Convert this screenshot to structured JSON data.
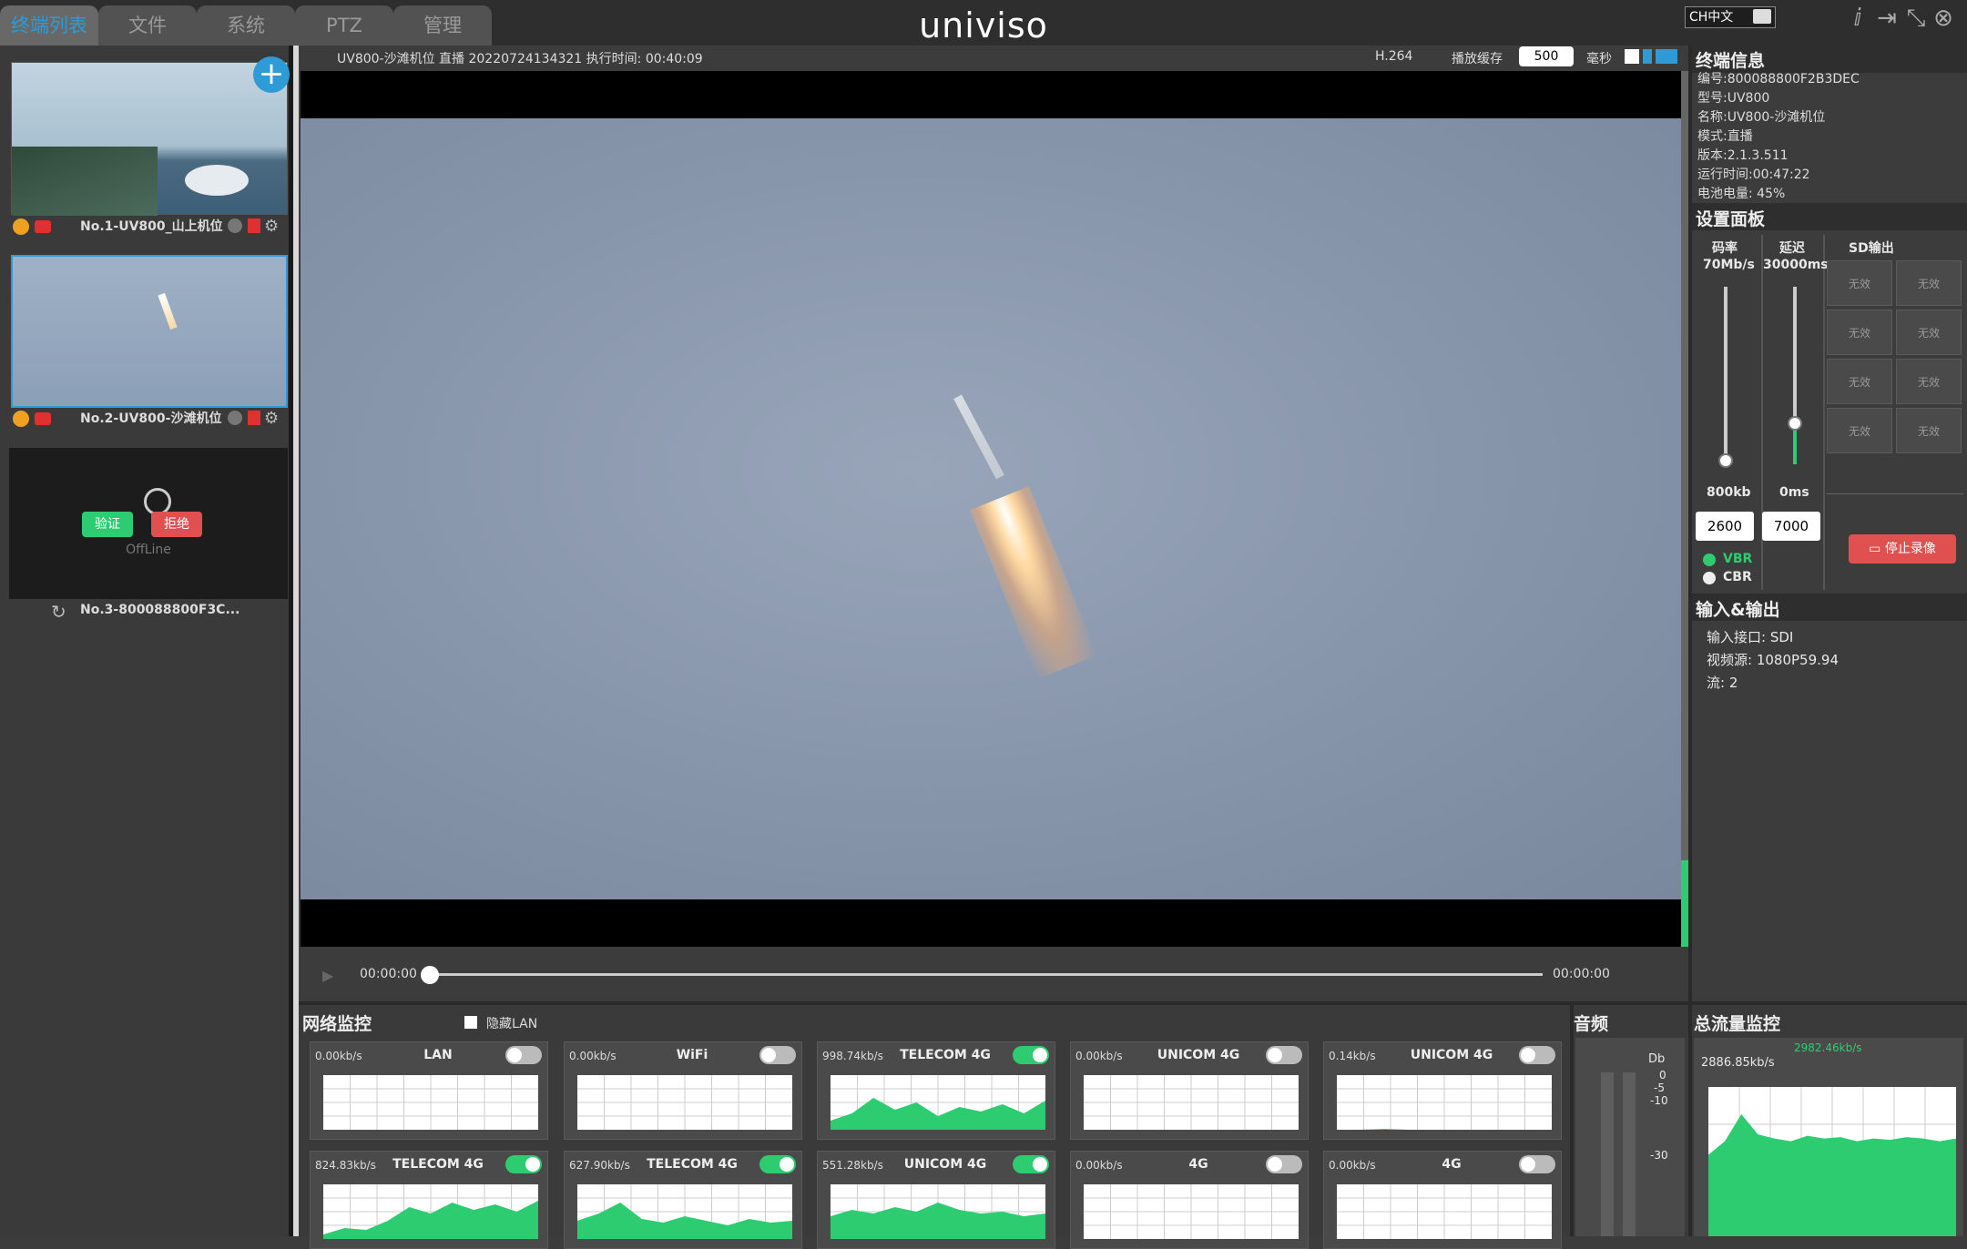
{
  "tabs": [
    "终端列表",
    "文件",
    "系统",
    "PTZ",
    "管理"
  ],
  "logo": "univiso",
  "lang": "CH中文",
  "devices": [
    {
      "label": "No.1-UV800_山上机位"
    },
    {
      "label": "No.2-UV800-沙滩机位"
    },
    {
      "label": "No.3-800088800F3C...",
      "status": "OffLine",
      "verify": "验证",
      "reject": "拒绝"
    }
  ],
  "stream_info": "UV800-沙滩机位 直播 20220724134321 执行时间: 00:40:09",
  "codec": "H.264",
  "cache_label": "播放缓存",
  "cache_value": "500",
  "cache_unit": "毫秒",
  "terminal_info": {
    "title": "终端信息",
    "lines": [
      "编号:800088800F2B3DEC",
      "型号:UV800",
      "名称:UV800-沙滩机位",
      "模式:直播",
      "版本:2.1.3.511",
      "运行时间:00:47:22",
      "电池电量: 45%"
    ]
  },
  "settings": {
    "title": "设置面板",
    "bitrate_label": "码率",
    "bitrate_max": "70Mb/s",
    "bitrate_min": "800kb",
    "bitrate_value": "2600",
    "bitrate_level": 0.02,
    "delay_label": "延迟",
    "delay_max": "30000ms",
    "delay_min": "0ms",
    "delay_value": "7000",
    "delay_level": 0.23,
    "vbr": "VBR",
    "cbr": "CBR",
    "sd_title": "SD输出",
    "sd_cells": [
      "无效",
      "无效",
      "无效",
      "无效",
      "无效",
      "无效",
      "无效",
      "无效"
    ],
    "stop_btn": "停止录像"
  },
  "io": {
    "title": "输入&输出",
    "lines": [
      "输入接口: SDI",
      "视频源: 1080P59.94",
      "流: 2"
    ]
  },
  "playback": {
    "start": "00:00:00",
    "end": "00:00:00"
  },
  "network": {
    "title": "网络监控",
    "hide_lan": "隐藏LAN",
    "cards": [
      {
        "rate": "0.00kb/s",
        "name": "LAN",
        "on": false,
        "data": [
          0,
          0,
          0,
          0,
          0,
          0,
          0,
          0,
          0,
          0
        ]
      },
      {
        "rate": "0.00kb/s",
        "name": "WiFi",
        "on": false,
        "data": [
          0,
          0,
          0,
          0,
          0,
          0,
          0,
          0,
          0,
          0
        ]
      },
      {
        "rate": "998.74kb/s",
        "name": "TELECOM 4G",
        "on": true,
        "data": [
          10,
          18,
          35,
          22,
          30,
          15,
          25,
          20,
          28,
          18,
          32
        ]
      },
      {
        "rate": "0.00kb/s",
        "name": "UNICOM 4G",
        "on": false,
        "data": [
          0,
          0,
          0,
          0,
          0,
          0,
          0,
          0,
          0,
          0
        ]
      },
      {
        "rate": "0.14kb/s",
        "name": "UNICOM 4G",
        "on": false,
        "data": [
          0,
          0,
          1,
          0,
          0,
          0,
          0,
          0,
          0,
          0
        ]
      },
      {
        "rate": "824.83kb/s",
        "name": "TELECOM 4G",
        "on": true,
        "data": [
          5,
          12,
          10,
          20,
          35,
          28,
          40,
          32,
          38,
          30,
          42
        ]
      },
      {
        "rate": "627.90kb/s",
        "name": "TELECOM 4G",
        "on": true,
        "data": [
          20,
          28,
          40,
          22,
          18,
          25,
          20,
          15,
          22,
          18,
          20
        ]
      },
      {
        "rate": "551.28kb/s",
        "name": "UNICOM 4G",
        "on": true,
        "data": [
          25,
          32,
          28,
          35,
          30,
          40,
          32,
          28,
          30,
          25,
          28
        ]
      },
      {
        "rate": "0.00kb/s",
        "name": "4G",
        "on": false,
        "data": [
          0,
          0,
          0,
          0,
          0,
          0,
          0,
          0,
          0,
          0
        ]
      },
      {
        "rate": "0.00kb/s",
        "name": "4G",
        "on": false,
        "data": [
          0,
          0,
          0,
          0,
          0,
          0,
          0,
          0,
          0,
          0
        ]
      }
    ]
  },
  "audio": {
    "title": "音频",
    "unit": "Db",
    "ticks": [
      "0",
      "-5",
      "-10",
      "-30"
    ]
  },
  "total_flow": {
    "title": "总流量监控",
    "value1": "2982.46kb/s",
    "value2": "2886.85kb/s",
    "data": [
      60,
      70,
      90,
      75,
      72,
      70,
      74,
      72,
      73,
      70,
      72,
      71,
      73,
      72,
      70,
      72
    ]
  },
  "colors": {
    "accent": "#2e9bd6",
    "green": "#2ecc71",
    "red": "#e05050"
  }
}
